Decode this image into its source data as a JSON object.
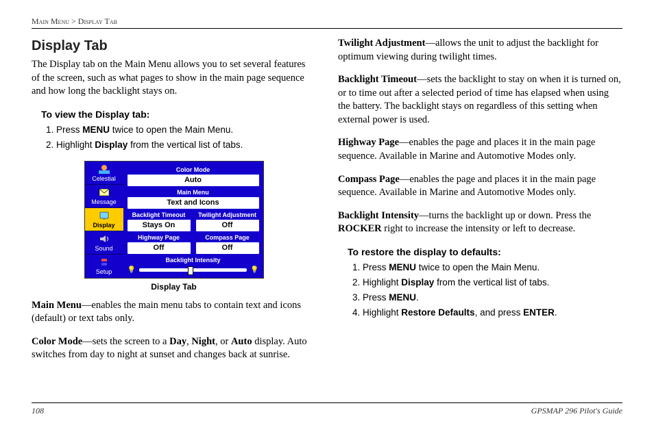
{
  "breadcrumb": {
    "a": "Main Menu",
    "sep": " > ",
    "b": "Display Tab"
  },
  "title": "Display Tab",
  "intro": "The Display tab on the Main Menu allows you to set several features of the screen, such as what pages to show in the main page sequence and how long the backlight stays on.",
  "howto_view": {
    "heading": "To view the Display tab:",
    "steps": [
      {
        "pre": "Press ",
        "b": "MENU",
        "post": " twice to open the Main Menu."
      },
      {
        "pre": "Highlight ",
        "b": "Display",
        "post": " from the vertical list of tabs."
      }
    ]
  },
  "figure": {
    "caption": "Display Tab",
    "sidebar": [
      "Celestial",
      "Message",
      "Display",
      "Sound",
      "Setup"
    ],
    "active": "Display",
    "fields": {
      "color_mode_label": "Color Mode",
      "color_mode_value": "Auto",
      "main_menu_label": "Main Menu",
      "main_menu_value": "Text and Icons",
      "backlight_timeout_label": "Backlight Timeout",
      "backlight_timeout_value": "Stays On",
      "twilight_label": "Twilight Adjustment",
      "twilight_value": "Off",
      "highway_label": "Highway Page",
      "highway_value": "Off",
      "compass_label": "Compass Page",
      "compass_value": "Off",
      "intensity_label": "Backlight Intensity"
    }
  },
  "defs": {
    "main_menu": {
      "term": "Main Menu",
      "text": "—enables the main menu tabs to contain text and icons (default) or text tabs only."
    },
    "color_mode": {
      "term": "Color Mode",
      "t1": "—sets the screen to a ",
      "b1": "Day",
      "t2": ", ",
      "b2": "Night",
      "t3": ", or ",
      "b3": "Auto",
      "t4": " display. Auto switches from day to night at sunset and changes back at sunrise."
    },
    "twilight": {
      "term": "Twilight Adjustment",
      "text": "—allows the unit to adjust the backlight for optimum viewing during twilight times."
    },
    "backlight_timeout": {
      "term": "Backlight Timeout",
      "text": "—sets the backlight to stay on when it is turned on, or to time out after a selected period of time has elapsed when using the battery. The backlight stays on regardless of this setting when external power is used."
    },
    "highway": {
      "term": "Highway Page",
      "text": "—enables the page and places it in the main page sequence. Available in Marine and Automotive Modes only."
    },
    "compass": {
      "term": "Compass Page",
      "text": "—enables the page and places it in the main page sequence. Available in Marine and Automotive Modes only."
    },
    "intensity": {
      "term": "Backlight Intensity",
      "t1": "—turns the backlight up or down. Press the ",
      "b1": "ROCKER",
      "t2": " right to increase the intensity or left to decrease."
    }
  },
  "howto_restore": {
    "heading": "To restore the display to defaults:",
    "steps": [
      {
        "pre": "Press ",
        "b": "MENU",
        "post": " twice to open the Main Menu."
      },
      {
        "pre": "Highlight ",
        "b": "Display",
        "post": " from the vertical list of tabs."
      },
      {
        "pre": "Press ",
        "b": "MENU",
        "post": "."
      },
      {
        "pre": "Highlight ",
        "b": "Restore Defaults",
        "post": ", and press ",
        "b2": "ENTER",
        "post2": "."
      }
    ]
  },
  "footer": {
    "page": "108",
    "title": "GPSMAP 296 Pilot's Guide"
  }
}
